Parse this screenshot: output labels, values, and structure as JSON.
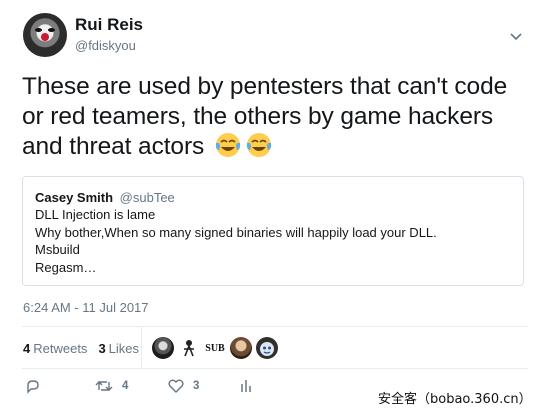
{
  "author": {
    "name": "Rui Reis",
    "handle": "@fdiskyou",
    "avatar_icon": "clown-avatar"
  },
  "tweet": {
    "text": "These are used by pentesters that can't code or red teamers, the others by game hackers and threat actors",
    "emojis": [
      "tears-of-joy-emoji",
      "tears-of-joy-emoji"
    ]
  },
  "quoted_tweet": {
    "name": "Casey Smith",
    "handle": "@subTee",
    "lines": [
      "DLL Injection is lame",
      "Why bother,When so many signed binaries will happily load your DLL.",
      "Msbuild",
      "Regasm…"
    ]
  },
  "timestamp": "6:24 AM - 11 Jul 2017",
  "stats": {
    "retweets_count": "4",
    "retweets_label": "Retweets",
    "likes_count": "3",
    "likes_label": "Likes"
  },
  "likers": [
    {
      "icon": "liker-avatar-1"
    },
    {
      "icon": "liker-avatar-2"
    },
    {
      "icon": "liker-avatar-3",
      "label": "SUB"
    },
    {
      "icon": "liker-avatar-4"
    },
    {
      "icon": "liker-avatar-5"
    }
  ],
  "actions": {
    "reply_count": "",
    "retweet_count": "4",
    "like_count": "3"
  },
  "watermark": "安全客（bobao.360.cn）",
  "colors": {
    "text": "#14171a",
    "secondary": "#657786",
    "border": "#e6ecf0",
    "emoji": "#ffcc4d"
  }
}
